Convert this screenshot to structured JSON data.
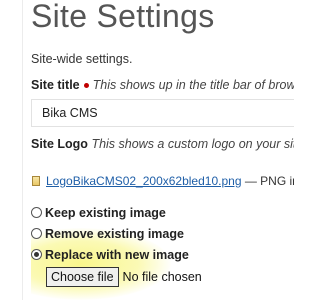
{
  "page": {
    "title": "Site Settings",
    "subtitle": "Site-wide settings."
  },
  "site_title": {
    "label": "Site title",
    "help": "This shows up in the title bar of browsers a",
    "value": "Bika CMS"
  },
  "site_logo": {
    "label": "Site Logo",
    "help": "This shows a custom logo on your site.",
    "current_file": "LogoBikaCMS02_200x62bled10.png",
    "file_type_text": "— PNG imag",
    "options": [
      {
        "label": "Keep existing image",
        "checked": false
      },
      {
        "label": "Remove existing image",
        "checked": false
      },
      {
        "label": "Replace with new image",
        "checked": true
      }
    ],
    "choose_file_label": "Choose file",
    "no_file_text": "No file chosen"
  },
  "colors": {
    "required": "#c00000",
    "link": "#1f5fa8",
    "highlight": "#f8f578"
  }
}
